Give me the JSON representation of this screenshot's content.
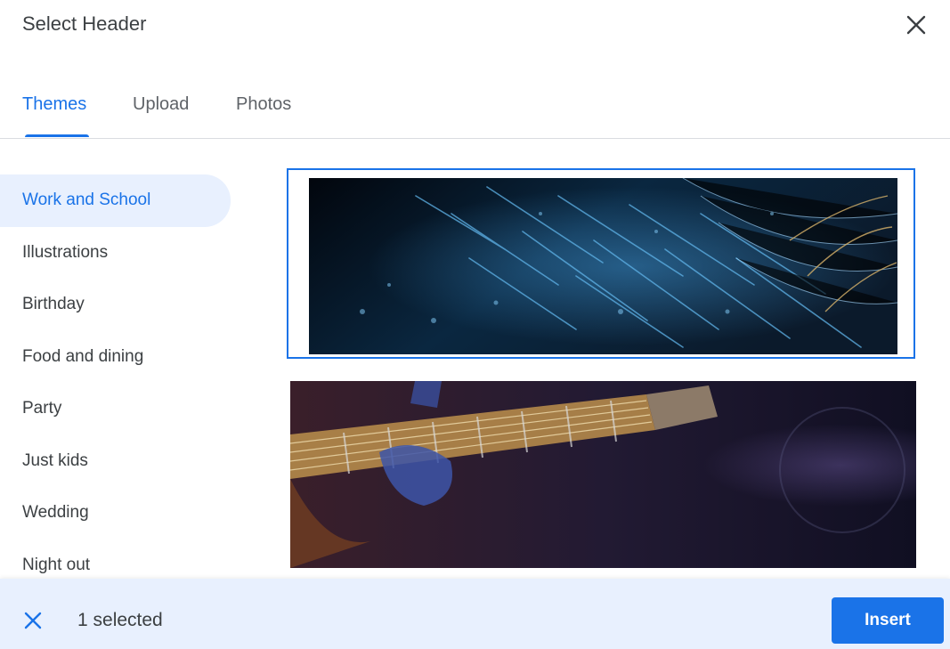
{
  "dialog": {
    "title": "Select Header",
    "close_icon": "close-icon"
  },
  "tabs": [
    {
      "label": "Themes",
      "active": true
    },
    {
      "label": "Upload",
      "active": false
    },
    {
      "label": "Photos",
      "active": false
    }
  ],
  "sidebar": {
    "items": [
      {
        "label": "Work and School",
        "active": true
      },
      {
        "label": "Illustrations",
        "active": false
      },
      {
        "label": "Birthday",
        "active": false
      },
      {
        "label": "Food and dining",
        "active": false
      },
      {
        "label": "Party",
        "active": false
      },
      {
        "label": "Just kids",
        "active": false
      },
      {
        "label": "Wedding",
        "active": false
      },
      {
        "label": "Night out",
        "active": false
      }
    ]
  },
  "gallery": {
    "images": [
      {
        "name": "abstract-blue-light-streaks-image",
        "selected": true
      },
      {
        "name": "guitar-player-image",
        "selected": false
      }
    ]
  },
  "footer": {
    "selected_text": "1 selected",
    "insert_label": "Insert",
    "clear_icon": "close-icon"
  },
  "colors": {
    "accent": "#1a73e8",
    "accent_light": "#e8f0fe",
    "text": "#3c4043",
    "muted": "#5f6368"
  }
}
